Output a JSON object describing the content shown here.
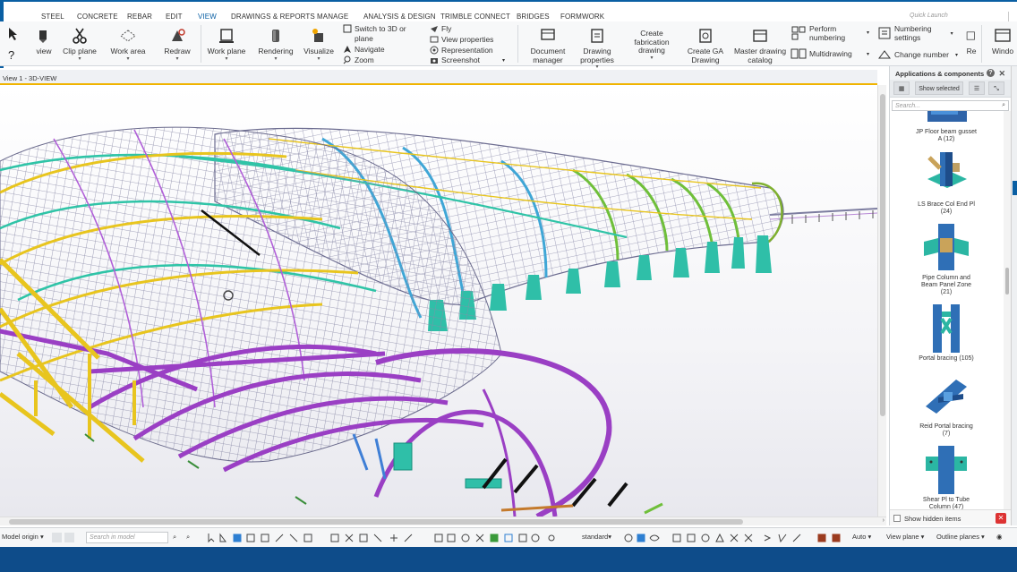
{
  "menu": {
    "tabs": [
      "STEEL",
      "CONCRETE",
      "REBAR",
      "EDIT",
      "VIEW",
      "DRAWINGS & REPORTS",
      "MANAGE",
      "ANALYSIS & DESIGN",
      "TRIMBLE CONNECT",
      "BRIDGES",
      "FORMWORK"
    ],
    "active": "VIEW",
    "quick_launch": "Quick Launch"
  },
  "ribbon": {
    "view": "view",
    "clip_plane": "Clip plane",
    "work_area": "Work area",
    "redraw": "Redraw",
    "work_plane": "Work plane",
    "rendering": "Rendering",
    "visualize": "Visualize",
    "switch_3d": "Switch to 3D or",
    "switch_3d_2": "plane",
    "navigate": "Navigate",
    "zoom": "Zoom",
    "fly": "Fly",
    "view_properties": "View properties",
    "representation": "Representation",
    "screenshot": "Screenshot",
    "document_manager": [
      "Document",
      "manager"
    ],
    "drawing_properties": [
      "Drawing",
      "properties"
    ],
    "create_fabrication": [
      "Create",
      "fabrication",
      "drawing"
    ],
    "create_ga": [
      "Create GA",
      "Drawing"
    ],
    "master_catalog": [
      "Master drawing",
      "catalog"
    ],
    "perform_numbering": [
      "Perform",
      "numbering"
    ],
    "multidrawing": "Multidrawing",
    "numbering_settings": [
      "Numbering",
      "settings"
    ],
    "change_number": "Change number",
    "re": "Re",
    "window": "Windo"
  },
  "viewport": {
    "title": "View 1 - 3D-VIEW"
  },
  "panel": {
    "title": "Applications & components",
    "show_selected": "Show selected",
    "search_placeholder": "Search...",
    "components": [
      {
        "name": "JP Floor beam gusset",
        "sub": "A (12)"
      },
      {
        "name": "LS Brace Col End Pl",
        "sub": "(24)"
      },
      {
        "name": "Pipe Column and",
        "sub": "Beam Panel Zone",
        "sub2": "(21)"
      },
      {
        "name": "Portal bracing (105)",
        "sub": ""
      },
      {
        "name": "Reid Portal bracing",
        "sub": "(7)"
      },
      {
        "name": "Shear Pl to Tube",
        "sub": "Column (47)"
      }
    ],
    "show_hidden": "Show hidden items"
  },
  "status": {
    "model_origin": "Model origin",
    "search_model": "Search in model",
    "standard": "standard",
    "auto": "Auto",
    "view_plane": "View plane",
    "outline_planes": "Outline planes"
  },
  "colors": {
    "accent": "#0a5fa3",
    "yellow": "#e9c21c",
    "purple": "#9a3fc4",
    "teal": "#2fbfa8",
    "footer": "#0e4c8a"
  }
}
